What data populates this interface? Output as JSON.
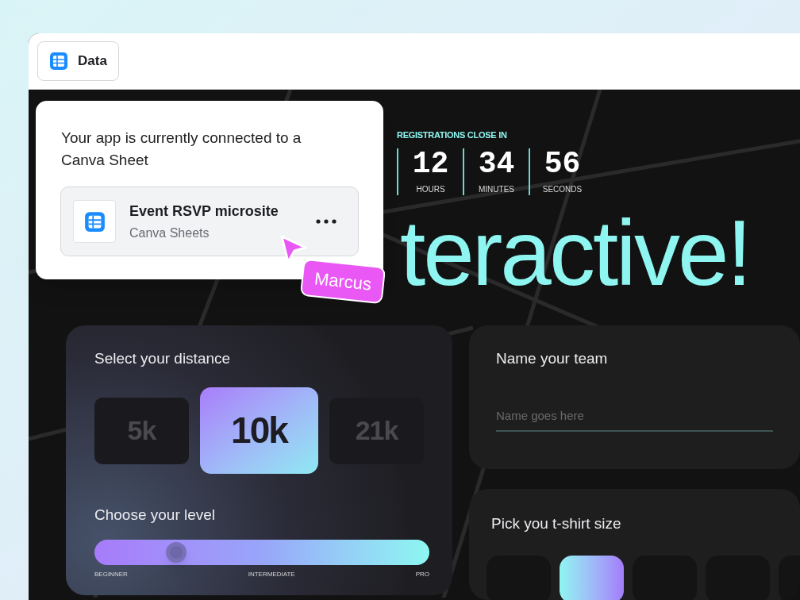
{
  "toolbar": {
    "button": {
      "label": "Data"
    }
  },
  "popup": {
    "message": "Your app is currently connected to a Canva Sheet",
    "source": {
      "title": "Event RSVP microsite",
      "subtitle": "Canva Sheets"
    }
  },
  "cursor": {
    "label": "Marcus",
    "color": "#e957f5"
  },
  "countdown": {
    "title": "REGISTRATIONS CLOSE IN",
    "units": [
      {
        "value": "12",
        "label": "HOURS"
      },
      {
        "value": "34",
        "label": "MINUTES"
      },
      {
        "value": "56",
        "label": "SECONDS"
      }
    ]
  },
  "heading": "teractive!",
  "distance": {
    "title": "Select your distance",
    "options": [
      {
        "label": "5k",
        "selected": false
      },
      {
        "label": "10k",
        "selected": true
      },
      {
        "label": "21k",
        "selected": false
      }
    ]
  },
  "level": {
    "title": "Choose your level",
    "level": 0.245,
    "labels": [
      "BEGINNER",
      "INTERMEDIATE",
      "PRO"
    ]
  },
  "team": {
    "title": "Name your team",
    "placeholder": "Name goes here"
  },
  "tshirt": {
    "title": "Pick you t-shirt size",
    "sizes": [
      {
        "selected": false
      },
      {
        "selected": true
      },
      {
        "selected": false
      },
      {
        "selected": false
      },
      {
        "selected": false
      }
    ]
  }
}
